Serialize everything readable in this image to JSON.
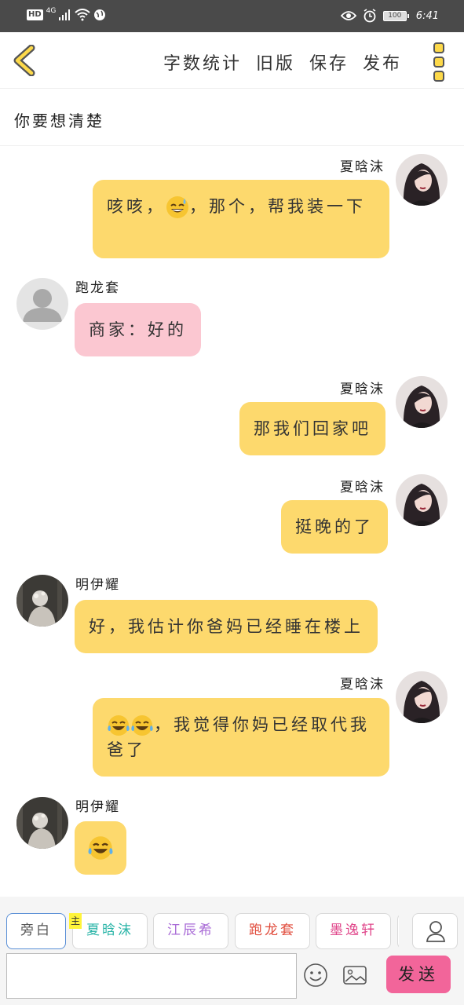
{
  "status_bar": {
    "network": "4G",
    "battery": "100",
    "time": "6:41"
  },
  "toolbar": {
    "word_count": "字数统计",
    "old_version": "旧版",
    "save": "保存",
    "publish": "发布"
  },
  "story_title": "你要想清楚",
  "messages": [
    {
      "speaker": "夏晗沫",
      "side": "right",
      "text_a": "咳咳，",
      "text_b": "，那个，帮我装一下"
    },
    {
      "speaker": "跑龙套",
      "side": "left",
      "text": "商家：好的"
    },
    {
      "speaker": "夏晗沫",
      "side": "right",
      "text": "那我们回家吧"
    },
    {
      "speaker": "夏晗沫",
      "side": "right",
      "text": "挺晚的了"
    },
    {
      "speaker": "明伊耀",
      "side": "left",
      "text": "好，我估计你爸妈已经睡在楼上"
    },
    {
      "speaker": "夏晗沫",
      "side": "right",
      "text": "，我觉得你妈已经取代我爸了"
    },
    {
      "speaker": "明伊耀",
      "side": "left",
      "text": ""
    }
  ],
  "roles": [
    {
      "label": "旁白",
      "color": "#555555"
    },
    {
      "label": "夏晗沫",
      "color": "#2bb5a8"
    },
    {
      "label": "江辰希",
      "color": "#a86ad6"
    },
    {
      "label": "跑龙套",
      "color": "#e04a3a"
    },
    {
      "label": "墨逸轩",
      "color": "#e0458a"
    }
  ],
  "host_badge": "主",
  "send_label": "发送",
  "colors": {
    "accent_yellow": "#fdd96d",
    "bubble_pink": "#fbc7d1",
    "send_pink": "#f2659a"
  }
}
